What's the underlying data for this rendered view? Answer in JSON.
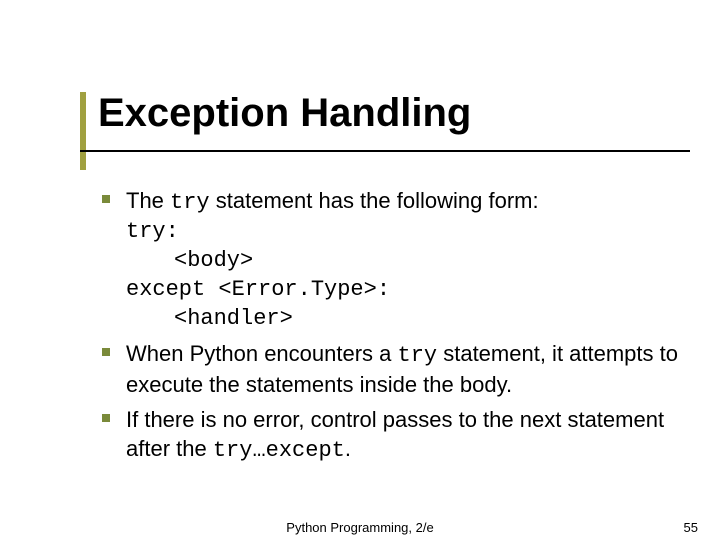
{
  "title": "Exception Handling",
  "bullets": [
    {
      "lead": "The ",
      "code1": "try",
      "mid": " statement has the following form:",
      "codeblock": [
        {
          "indent": 1,
          "text": "try:"
        },
        {
          "indent": 2,
          "text": "<body>"
        },
        {
          "indent": 1,
          "text": "except <Error.Type>:"
        },
        {
          "indent": 2,
          "text": "<handler>"
        }
      ]
    },
    {
      "lead": "When Python encounters a ",
      "code1": "try",
      "mid": " statement, it attempts to execute the statements inside the body."
    },
    {
      "lead": "If there is no error, control passes to the next statement after the ",
      "code1": "try…except",
      "mid": "."
    }
  ],
  "footer_center": "Python Programming, 2/e",
  "footer_right": "55"
}
